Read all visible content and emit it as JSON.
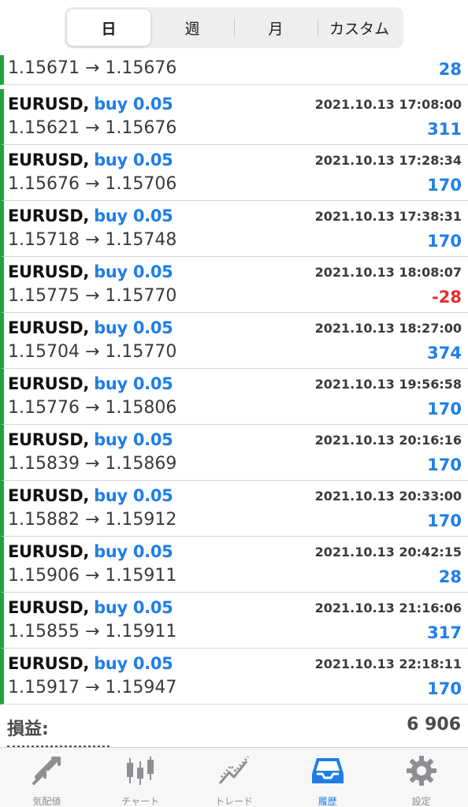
{
  "segments": [
    {
      "label": "日",
      "active": true
    },
    {
      "label": "週",
      "active": false
    },
    {
      "label": "月",
      "active": false
    },
    {
      "label": "カスタム",
      "active": false
    }
  ],
  "partial_row": {
    "prices": "1.15671 → 1.15676",
    "profit": "28"
  },
  "rows": [
    {
      "symbol": "EURUSD",
      "side": "buy 0.05",
      "time": "2021.10.13 17:08:00",
      "prices": "1.15621 → 1.15676",
      "profit": "311",
      "negative": false
    },
    {
      "symbol": "EURUSD",
      "side": "buy 0.05",
      "time": "2021.10.13 17:28:34",
      "prices": "1.15676 → 1.15706",
      "profit": "170",
      "negative": false
    },
    {
      "symbol": "EURUSD",
      "side": "buy 0.05",
      "time": "2021.10.13 17:38:31",
      "prices": "1.15718 → 1.15748",
      "profit": "170",
      "negative": false
    },
    {
      "symbol": "EURUSD",
      "side": "buy 0.05",
      "time": "2021.10.13 18:08:07",
      "prices": "1.15775 → 1.15770",
      "profit": "-28",
      "negative": true
    },
    {
      "symbol": "EURUSD",
      "side": "buy 0.05",
      "time": "2021.10.13 18:27:00",
      "prices": "1.15704 → 1.15770",
      "profit": "374",
      "negative": false
    },
    {
      "symbol": "EURUSD",
      "side": "buy 0.05",
      "time": "2021.10.13 19:56:58",
      "prices": "1.15776 → 1.15806",
      "profit": "170",
      "negative": false
    },
    {
      "symbol": "EURUSD",
      "side": "buy 0.05",
      "time": "2021.10.13 20:16:16",
      "prices": "1.15839 → 1.15869",
      "profit": "170",
      "negative": false
    },
    {
      "symbol": "EURUSD",
      "side": "buy 0.05",
      "time": "2021.10.13 20:33:00",
      "prices": "1.15882 → 1.15912",
      "profit": "170",
      "negative": false
    },
    {
      "symbol": "EURUSD",
      "side": "buy 0.05",
      "time": "2021.10.13 20:42:15",
      "prices": "1.15906 → 1.15911",
      "profit": "28",
      "negative": false
    },
    {
      "symbol": "EURUSD",
      "side": "buy 0.05",
      "time": "2021.10.13 21:16:06",
      "prices": "1.15855 → 1.15911",
      "profit": "317",
      "negative": false
    },
    {
      "symbol": "EURUSD",
      "side": "buy 0.05",
      "time": "2021.10.13 22:18:11",
      "prices": "1.15917 → 1.15947",
      "profit": "170",
      "negative": false
    }
  ],
  "summary": {
    "label": "損益:",
    "value": "6 906"
  },
  "tabs": [
    {
      "label": "気配値",
      "icon": "quotes-icon",
      "active": false
    },
    {
      "label": "チャート",
      "icon": "candlestick-chart-icon",
      "active": false
    },
    {
      "label": "トレード",
      "icon": "trade-line-icon",
      "active": false
    },
    {
      "label": "履歴",
      "icon": "history-tray-icon",
      "active": true
    },
    {
      "label": "設定",
      "icon": "gear-icon",
      "active": false
    }
  ],
  "colors": {
    "accent": "#1f7ee6",
    "negative": "#e0302a",
    "row_marker": "#1fa33a",
    "inactive_icon": "#8e8e93"
  }
}
